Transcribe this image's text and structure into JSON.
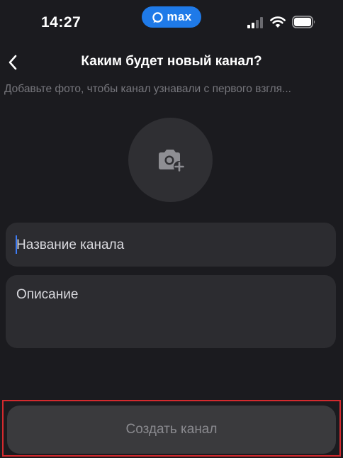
{
  "status_bar": {
    "time": "14:27",
    "app_badge": "max"
  },
  "header": {
    "title": "Каким будет новый канал?",
    "subtitle": "Добавьте фото, чтобы канал узнавали с первого взгля..."
  },
  "form": {
    "name_placeholder": "Название канала",
    "description_placeholder": "Описание"
  },
  "actions": {
    "create_label": "Создать канал"
  },
  "colors": {
    "background": "#1b1b1f",
    "field": "#2c2c30",
    "accent": "#1f7ae8",
    "highlight": "#d42a2e"
  },
  "icons": {
    "back": "chevron-left-icon",
    "photo": "camera-plus-icon",
    "signal": "cellular-signal-icon",
    "wifi": "wifi-icon",
    "battery": "battery-icon"
  }
}
